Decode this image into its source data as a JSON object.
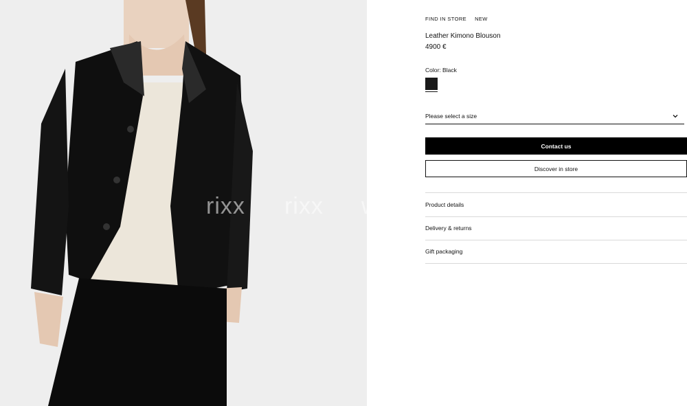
{
  "product_image": {
    "watermarks": [
      "rixx",
      "rixx",
      "w"
    ]
  },
  "header_links": {
    "find_in_store": "FIND IN STORE",
    "new_badge": "NEW"
  },
  "product": {
    "title": "Leather Kimono Blouson",
    "price": "4900 €",
    "color_label": "Color: Black",
    "swatch_color": "#1a1a1a"
  },
  "size_select": {
    "placeholder": "Please select a size",
    "icon": "chevron-down-icon"
  },
  "actions": {
    "contact_label": "Contact us",
    "discover_label": "Discover in store"
  },
  "accordion": [
    {
      "label": "Product details"
    },
    {
      "label": "Delivery & returns"
    },
    {
      "label": "Gift packaging"
    }
  ]
}
